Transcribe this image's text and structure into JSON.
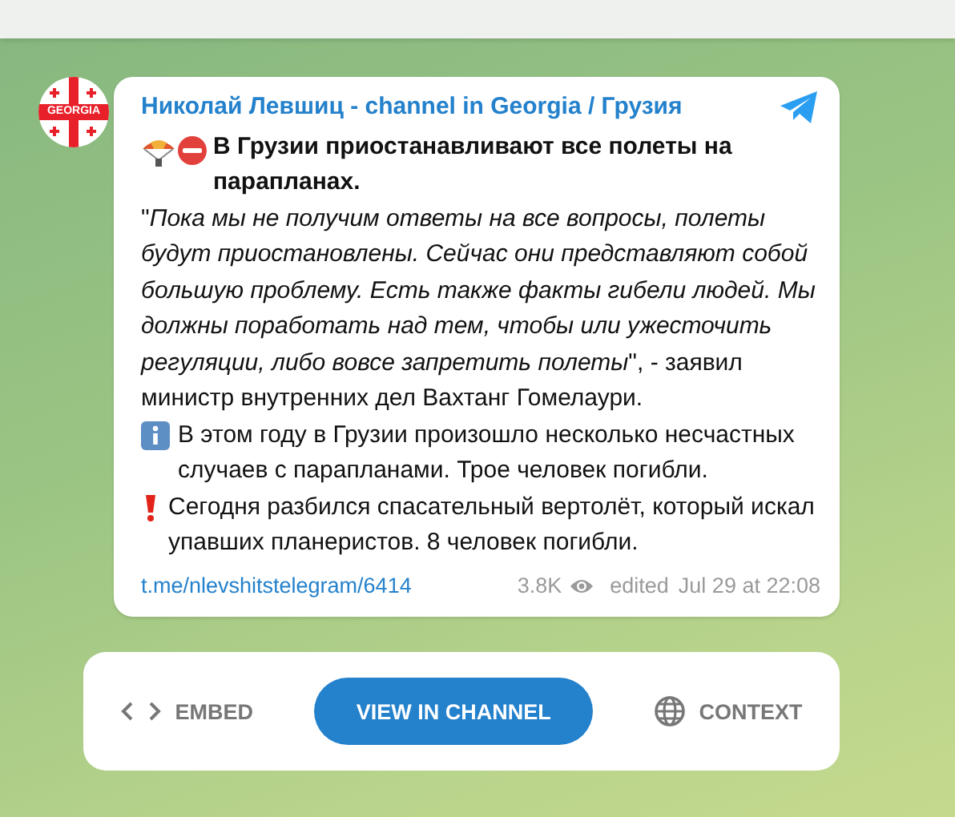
{
  "channel": {
    "title": "Николай Левшиц - channel in Georgia / Грузия",
    "avatar_text": "GEORGIA"
  },
  "post": {
    "paragraphs": [
      {
        "kind": "headline",
        "text": "В Грузии приостанавливают все полеты на парапланах."
      },
      {
        "kind": "quote",
        "text": "\"*Пока мы не получим ответы на все вопросы, полеты будут приостановлены. Сейчас они представляют собой большую проблему. Есть также факты гибели людей. Мы должны поработать над тем, чтобы или ужесточить регуляции, либо вовсе запретить полеты*\", - заявил министр внутренних дел Вахтанг Гомелаури."
      },
      {
        "kind": "info",
        "text": "В этом году в Грузии произошло несколько несчастных случаев с парапланами. Трое человек погибли."
      },
      {
        "kind": "alert",
        "text": "Сегодня разбился спасательный вертолёт, который искал упавших планеристов. 8 человек погибли."
      }
    ],
    "link": "t.me/nlevshitstelegram/6414",
    "views": "3.8K",
    "edited": "edited",
    "date": "Jul 29 at 22:08"
  },
  "actions": [
    {
      "kind": "embed",
      "label": "EMBED"
    },
    {
      "kind": "primary",
      "label": "VIEW IN CHANNEL"
    },
    {
      "kind": "context",
      "label": "CONTEXT"
    }
  ]
}
